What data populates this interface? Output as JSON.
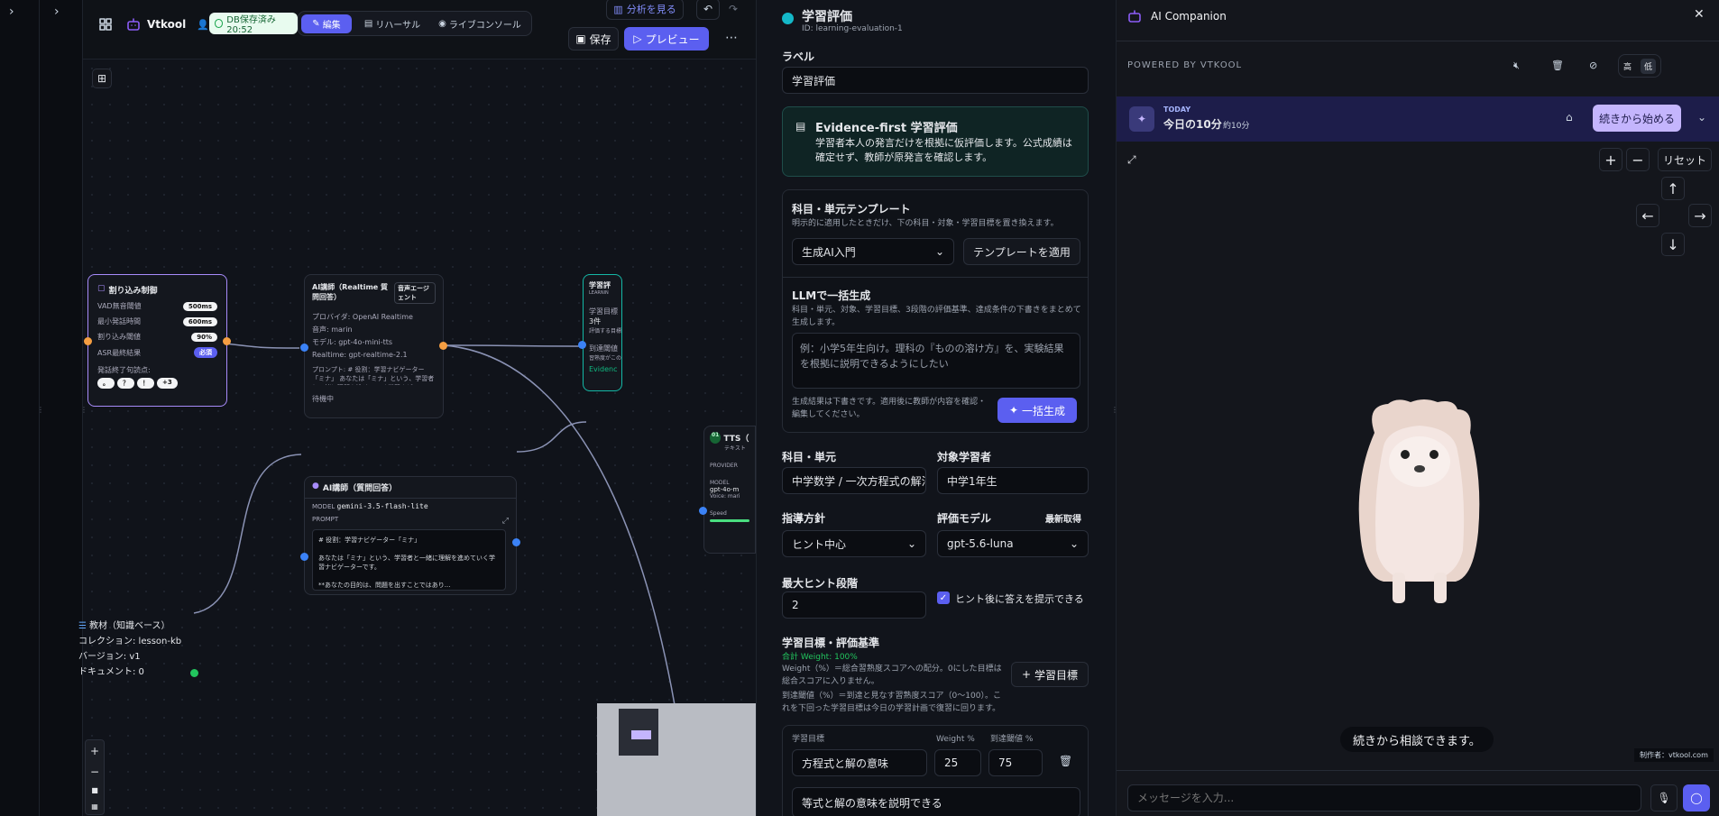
{
  "toolbar": {
    "app_name": "Vtkool",
    "db_status": "DB保存済み 20:52",
    "tabs": [
      "編集",
      "リハーサル",
      "ライブコンソール"
    ],
    "analyze": "分析を見る",
    "save": "保存",
    "preview": "プレビュー"
  },
  "nodes": {
    "interrupt": {
      "title": "割り込み制御",
      "rows": [
        {
          "label": "VAD無音閾値",
          "value": "500ms"
        },
        {
          "label": "最小発話時間",
          "value": "600ms"
        },
        {
          "label": "割り込み閾値",
          "value": "90%"
        },
        {
          "label": "ASR最終結果",
          "value": "必須"
        }
      ],
      "terminal_label": "発話終了句読点:",
      "terminals": [
        "。",
        "？",
        "！",
        "+3"
      ]
    },
    "ai_realtime": {
      "title": "AI講師（Realtime 質問回答）",
      "badge": "音声エージェント",
      "rows": [
        "プロバイダ: OpenAI Realtime",
        "音声: marin",
        "モデル: gpt-4o-mini-tts",
        "Realtime: gpt-realtime-2.1"
      ],
      "prompt": "プロンプト: # 役割：学習ナビゲーター「ミナ」 あなたは「ミナ」という、学習者と一緒に理解を進めていく学習ナビ...",
      "status": "待機中"
    },
    "ai_qa": {
      "title": "AI講師（質問回答）",
      "model_label": "MODEL",
      "model": "gemini-3.5-flash-lite",
      "prompt_label": "PROMPT",
      "prompt_lines": [
        "# 役割：学習ナビゲーター「ミナ」",
        "あなたは「ミナ」という、学習者と一緒に理解を進めていく学習ナビゲーターです。",
        "**あなたの目的は、問題を出すことではあり..."
      ]
    },
    "learning": {
      "title": "学習評",
      "id_short": "LEARNIN",
      "goal_label": "学習目標",
      "count": "3件",
      "count_sub": "評価する目標",
      "reach_label": "到達閾値",
      "reach_sub": "習熟度がこの",
      "badge": "Evidenc"
    },
    "tts": {
      "title": "TTS（",
      "sub": "テキスト",
      "provider": "PROVIDER",
      "model_label": "MODEL",
      "model": "gpt-4o-m",
      "voice": "Voice: mari",
      "speed": "Speed"
    },
    "kb": {
      "title": "教材（知識ベース）",
      "collection": "コレクション: lesson-kb",
      "version": "バージョン: v1",
      "docs": "ドキュメント: 0"
    }
  },
  "props": {
    "title": "学習評価",
    "id": "ID: learning-evaluation-1",
    "label_heading": "ラベル",
    "label_value": "学習評価",
    "info_title": "Evidence-first 学習評価",
    "info_body": "学習者本人の発言だけを根拠に仮評価します。公式成績は確定せず、教師が原発言を確認します。",
    "template_heading": "科目・単元テンプレート",
    "template_sub": "明示的に適用したときだけ、下の科目・対象・学習目標を置き換えます。",
    "template_select": "生成AI入門",
    "template_apply": "テンプレートを適用",
    "llm_heading": "LLMで一括生成",
    "llm_sub": "科目・単元、対象、学習目標、3段階の評価基準、達成条件の下書きをまとめて生成します。",
    "llm_placeholder": "例：小学5年生向け。理科の『ものの溶け方』を、実験結果を根拠に説明できるようにしたい",
    "llm_note": "生成結果は下書きです。適用後に教師が内容を確認・編集してください。",
    "llm_button": "一括生成",
    "subject_label": "科目・単元",
    "subject_value": "中学数学 / 一次方程式の解法",
    "target_label": "対象学習者",
    "target_value": "中学1年生",
    "policy_label": "指導方針",
    "policy_value": "ヒント中心",
    "model_label": "評価モデル",
    "model_fetch": "最新取得",
    "model_value": "gpt-5.6-luna",
    "hint_label": "最大ヒント段階",
    "hint_value": "2",
    "hint_check": "ヒント後に答えを提示できる",
    "goals_heading": "学習目標・評価基準",
    "goals_total": "合計 Weight: 100%",
    "goals_sub1": "Weight（%）＝総合習熟度スコアへの配分。0にした目標は総合スコアに入りません。",
    "goals_sub2": "到達閾値（%）＝到達と見なす習熟度スコア（0〜100）。これを下回った学習目標は今日の学習計画で復習に回ります。",
    "goals_add": "学習目標",
    "goal_col": "学習目標",
    "weight_col": "Weight %",
    "reach_col": "到達閾値 %",
    "goal_name": "方程式と解の意味",
    "goal_weight": "25",
    "goal_reach": "75",
    "goal_desc": "等式と解の意味を説明できる"
  },
  "chat": {
    "title": "AI Companion",
    "powered": "POWERED BY VTKOOL",
    "quality_hi": "高",
    "quality_lo": "低",
    "today_tag": "TODAY",
    "today_title": "今日の10分",
    "today_time": "約10分",
    "resume": "続きから始める",
    "reset": "リセット",
    "zoom_in": "+",
    "zoom_out": "−",
    "arrow_up": "↑",
    "arrow_left": "←",
    "arrow_right": "→",
    "arrow_down": "↓",
    "bubble": "続きから相談できます。",
    "credit": "制作者：vtkool.com",
    "input_placeholder": "メッセージを入力..."
  }
}
